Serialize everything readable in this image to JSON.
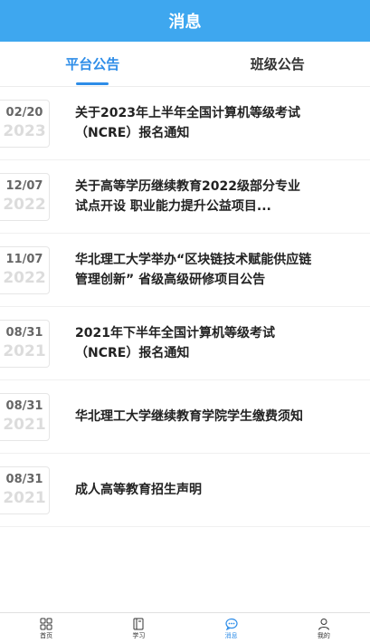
{
  "header": {
    "title": "消息"
  },
  "tabs": [
    {
      "label": "平台公告",
      "active": true
    },
    {
      "label": "班级公告",
      "active": false
    }
  ],
  "announcements": [
    {
      "date": "02/20",
      "year": "2023",
      "title": "关于2023年上半年全国计算机等级考试（NCRE）报名通知"
    },
    {
      "date": "12/07",
      "year": "2022",
      "title": "关于高等学历继续教育2022级部分专业试点开设 职业能力提升公益项目..."
    },
    {
      "date": "11/07",
      "year": "2022",
      "title": "华北理工大学举办“区块链技术赋能供应链管理创新” 省级高级研修项目公告"
    },
    {
      "date": "08/31",
      "year": "2021",
      "title": "2021年下半年全国计算机等级考试（NCRE）报名通知"
    },
    {
      "date": "08/31",
      "year": "2021",
      "title": "华北理工大学继续教育学院学生缴费须知"
    },
    {
      "date": "08/31",
      "year": "2021",
      "title": "成人高等教育招生声明"
    }
  ],
  "bottom_nav": [
    {
      "label": "首页",
      "icon": "grid-icon",
      "active": false
    },
    {
      "label": "学习",
      "icon": "book-icon",
      "active": false
    },
    {
      "label": "消息",
      "icon": "chat-icon",
      "active": true
    },
    {
      "label": "我的",
      "icon": "user-icon",
      "active": false
    }
  ],
  "colors": {
    "header_bg": "#3ea7ef",
    "accent": "#2e8de8"
  }
}
